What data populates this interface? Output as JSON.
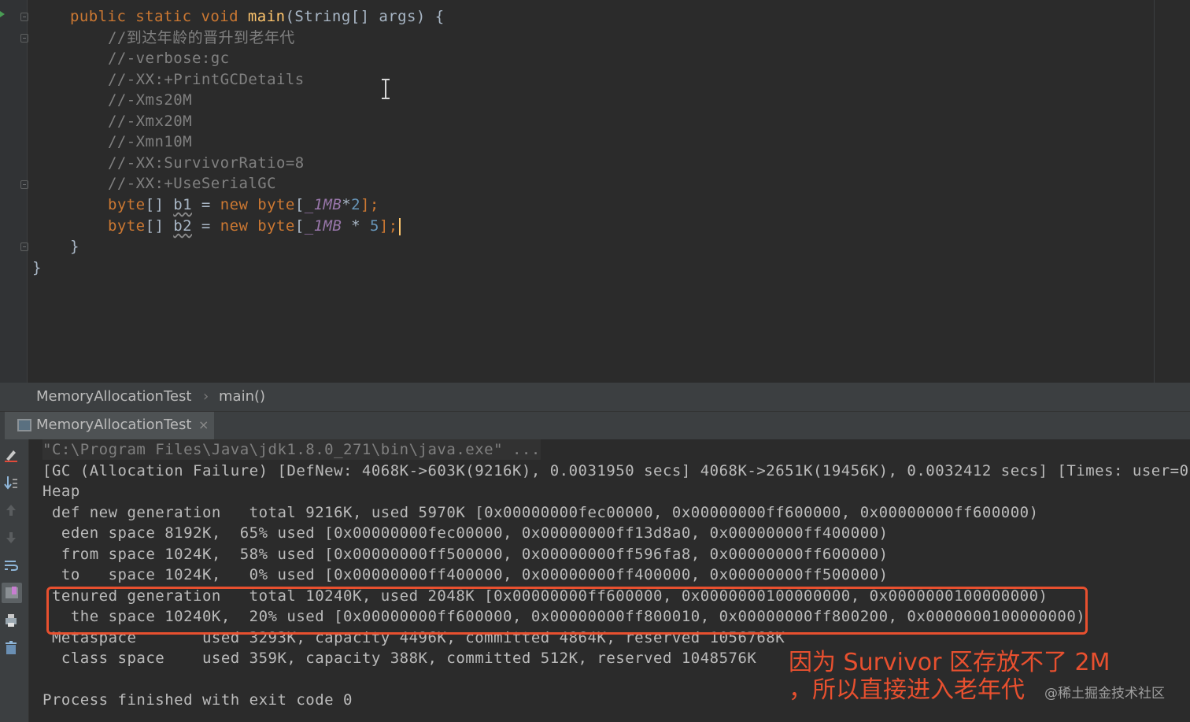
{
  "editor": {
    "lines": {
      "l1": {
        "t1": "public ",
        "t2": "static ",
        "t3": "void ",
        "t4": "main",
        "t5": "(String[] args) {"
      },
      "l2": "//到达年龄的晋升到老年代",
      "l3": "//-verbose:gc",
      "l4": "//-XX:+PrintGCDetails",
      "l5": "//-Xms20M",
      "l6": "//-Xmx20M",
      "l7": "//-Xmn10M",
      "l8": "//-XX:SurvivorRatio=8",
      "l9": "//-XX:+UseSerialGC",
      "l10": {
        "t1": "byte",
        "t2": "[] ",
        "t3": "b1",
        "t4": " = ",
        "t5": "new ",
        "t6": "byte",
        "t7": "[",
        "t8": "_1MB",
        "t9": "*",
        "t10": "2",
        "t11": "];"
      },
      "l11": {
        "t1": "byte",
        "t2": "[] ",
        "t3": "b2",
        "t4": " = ",
        "t5": "new ",
        "t6": "byte",
        "t7": "[",
        "t8": "_1MB",
        "t9": " * ",
        "t10": "5",
        "t11": "];"
      },
      "l12": "}",
      "l13": "}"
    }
  },
  "breadcrumb": {
    "class_name": "MemoryAllocationTest",
    "separator": "›",
    "method": "main()"
  },
  "run_tab": {
    "label": "MemoryAllocationTest",
    "close": "×"
  },
  "console": {
    "lines": [
      "\"C:\\Program Files\\Java\\jdk1.8.0_271\\bin\\java.exe\" ...",
      "[GC (Allocation Failure) [DefNew: 4068K->603K(9216K), 0.0031950 secs] 4068K->2651K(19456K), 0.0032412 secs] [Times: user=0.",
      "Heap",
      " def new generation   total 9216K, used 5970K [0x00000000fec00000, 0x00000000ff600000, 0x00000000ff600000)",
      "  eden space 8192K,  65% used [0x00000000fec00000, 0x00000000ff13d8a0, 0x00000000ff400000)",
      "  from space 1024K,  58% used [0x00000000ff500000, 0x00000000ff596fa8, 0x00000000ff600000)",
      "  to   space 1024K,   0% used [0x00000000ff400000, 0x00000000ff400000, 0x00000000ff500000)",
      " tenured generation   total 10240K, used 2048K [0x00000000ff600000, 0x0000000100000000, 0x0000000100000000)",
      "   the space 10240K,  20% used [0x00000000ff600000, 0x00000000ff800010, 0x00000000ff800200, 0x0000000100000000)",
      " Metaspace       used 3293K, capacity 4496K, committed 4864K, reserved 1056768K",
      "  class space    used 359K, capacity 388K, committed 512K, reserved 1048576K",
      "",
      "Process finished with exit code 0"
    ],
    "annotation": "因为 Survivor 区存放不了 2M\n，所以直接进入老年代",
    "watermark": "@稀土掘金技术社区"
  },
  "colors": {
    "highlight": "#e8502f",
    "keyword": "#cc7832",
    "method": "#ffc66d",
    "comment": "#808080",
    "constant": "#9876aa",
    "number": "#6897bb"
  },
  "toolbar_icons": [
    "edit-icon",
    "scroll-to-end-icon",
    "up-arrow-icon",
    "down-arrow-icon",
    "soft-wrap-icon",
    "pin-tab-icon",
    "print-icon",
    "trash-icon"
  ]
}
